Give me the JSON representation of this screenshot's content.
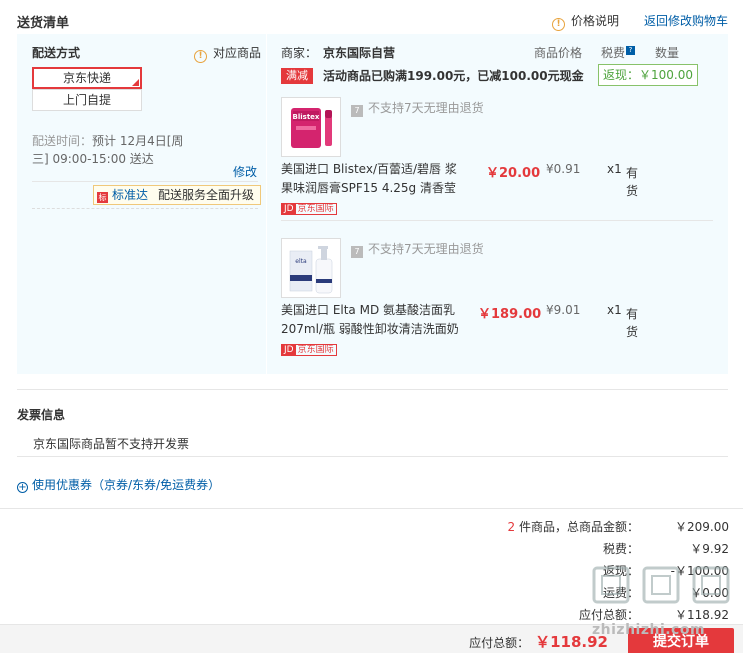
{
  "header": {
    "title": "送货清单",
    "price_info": "价格说明",
    "back_cart": "返回修改购物车"
  },
  "shipping": {
    "label": "配送方式",
    "corresponding_goods": "对应商品",
    "option_selected": "京东快递",
    "option_pickup": "上门自提",
    "time_label": "配送时间：",
    "time_value": "预计 12月4日[周三] 09:00-15:00 送达",
    "modify": "修改",
    "upgrade_tag": "标准达",
    "upgrade_text": "配送服务全面升级"
  },
  "merchant": {
    "label": "商家：",
    "name": "京东国际自营",
    "col_price": "商品价格",
    "col_tax": "税费",
    "col_qty": "数量",
    "promo_tag": "满减",
    "promo_text": "活动商品已购满199.00元，已减100.00元现金",
    "rebate": "返现：￥100.00"
  },
  "items": [
    {
      "no_return": "不支持7天无理由退货",
      "name": "美国进口 Blistex/百蕾适/碧唇 浆果味润唇膏SPF15 4.25g 清香莹",
      "price": "￥20.00",
      "tax": "¥0.91",
      "qty": "x1",
      "stock": "有货",
      "badge_jd": "JD",
      "badge_text": "京东国际",
      "thumb_brand": "Blistex"
    },
    {
      "no_return": "不支持7天无理由退货",
      "name": "美国进口 Elta MD 氨基酸洁面乳 207ml/瓶 弱酸性卸妆清洁洗面奶",
      "price": "￥189.00",
      "tax": "¥9.01",
      "qty": "x1",
      "stock": "有货",
      "badge_jd": "JD",
      "badge_text": "京东国际",
      "thumb_brand": "elta"
    }
  ],
  "invoice": {
    "title": "发票信息",
    "text": "京东国际商品暂不支持开发票"
  },
  "coupon": {
    "text": "使用优惠券（京券/东券/免运费券）"
  },
  "summary": {
    "count": "2",
    "count_label": "件商品，总商品金额：",
    "total": "￥209.00",
    "tax_label": "税费：",
    "tax": "￥9.92",
    "rebate_label": "返现：",
    "rebate": "-￥100.00",
    "freight_label": "运费：",
    "freight": "￥0.00",
    "due_label": "应付总额：",
    "due_small": "￥118.92",
    "due_total_label": "应付总额：",
    "due_total": "￥118.92",
    "submit": "提交订单"
  },
  "watermark": {
    "text": "zhizhizhi.com"
  },
  "colors": {
    "accent": "#e4393c",
    "link": "#005ea7",
    "panel": "#f3fbfe",
    "rebate_green": "#4ea33d"
  }
}
